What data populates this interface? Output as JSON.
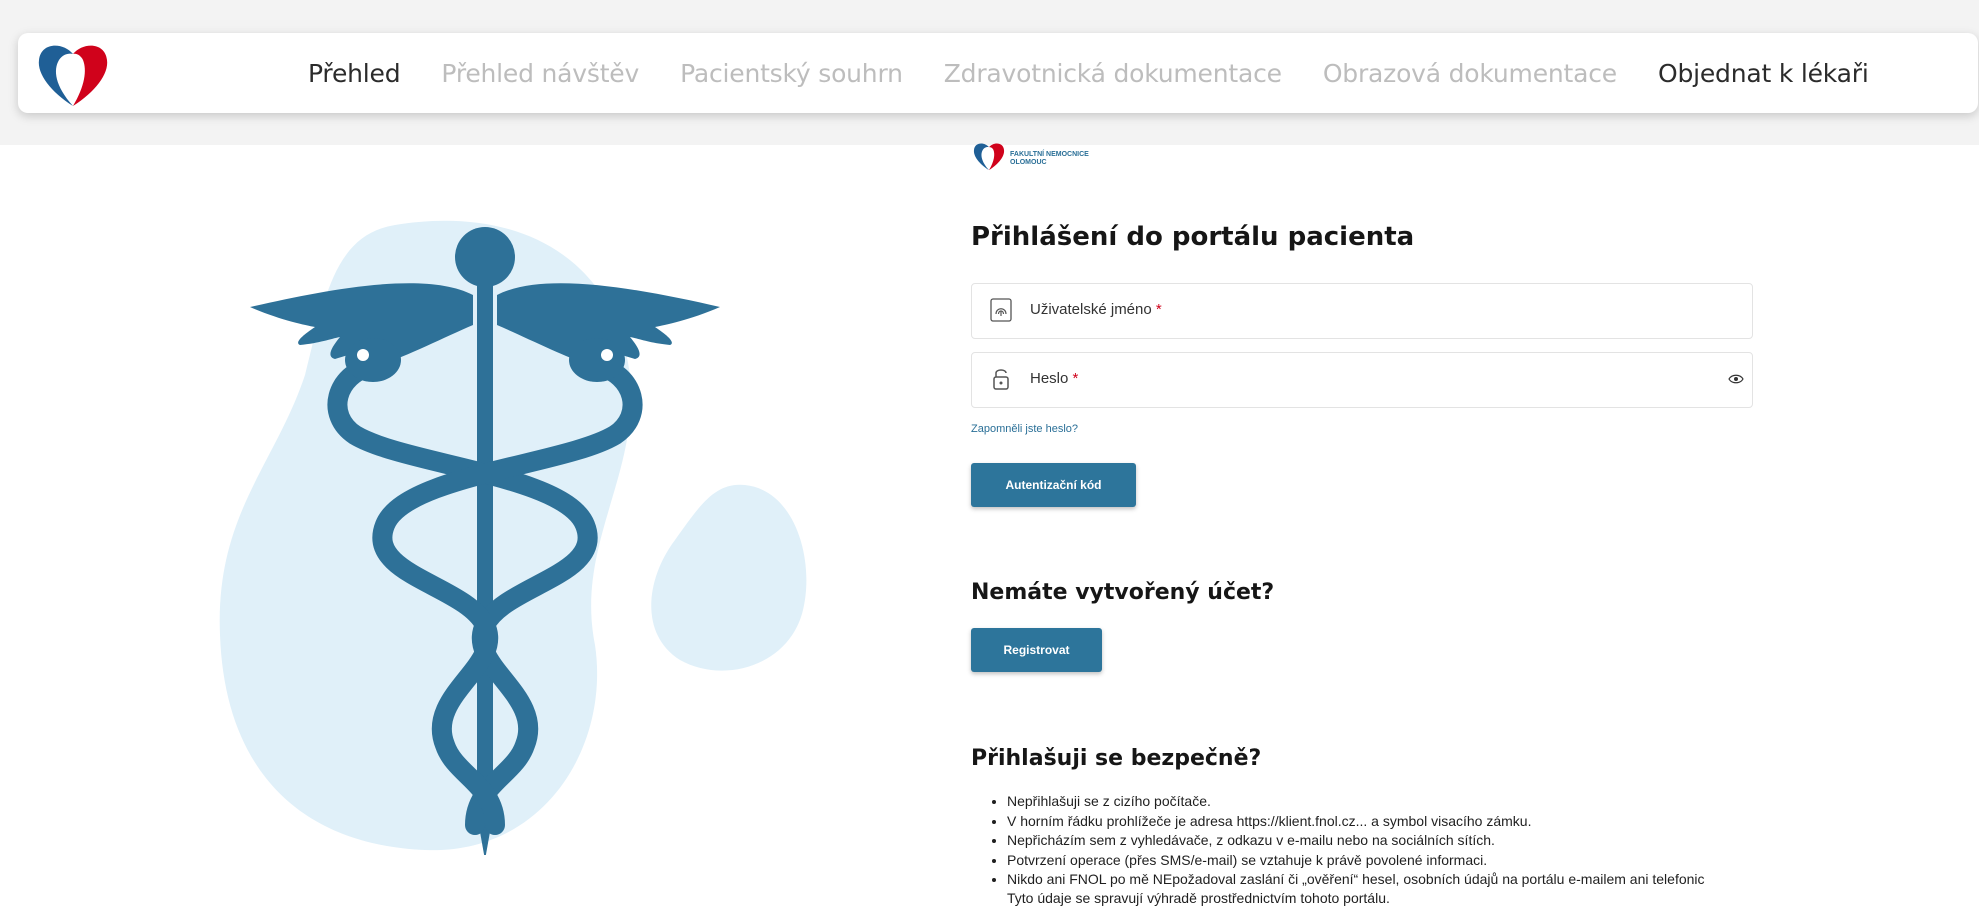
{
  "nav": {
    "tabs": [
      {
        "label": "Přehled",
        "active": true
      },
      {
        "label": "Přehled návštěv",
        "active": false
      },
      {
        "label": "Pacientský souhrn",
        "active": false
      },
      {
        "label": "Zdravotnická dokumentace",
        "active": false
      },
      {
        "label": "Obrazová dokumentace",
        "active": false
      },
      {
        "label": "Objednat k lékaři",
        "active": false
      }
    ]
  },
  "brand": {
    "logo_line1": "FAKULTNÍ NEMOCNICE",
    "logo_line2": "OLOMOUC",
    "primary_color": "#2d759b",
    "accent_color": "#d0021b"
  },
  "login": {
    "title": "Přihlášení do portálu pacienta",
    "username_label": "Uživatelské jméno",
    "password_label": "Heslo",
    "required_mark": "*",
    "forgot_link": "Zapomněli jste heslo?",
    "auth_button": "Autentizační kód"
  },
  "register": {
    "title": "Nemáte vytvořený účet?",
    "button": "Registrovat"
  },
  "security": {
    "title": "Přihlašuji se bezpečně?",
    "tips": [
      "Nepřihlašuji se z cizího počítače.",
      "V horním řádku prohlížeče je adresa https://klient.fnol.cz... a symbol visacího zámku.",
      "Nepřicházím sem z vyhledávače, z odkazu v e-mailu nebo na sociálních sítích.",
      "Potvrzení operace (přes SMS/e-mail) se vztahuje k právě povolené informaci.",
      "Nikdo ani FNOL po mě NEpožadoval zaslání či „ověření“ hesel, osobních údajů na portálu e-mailem ani telefonic"
    ],
    "tip_continuation": "Tyto údaje se spravují výhradě prostřednictvím tohoto portálu."
  },
  "icons": {
    "nav_logo": "heart-logo-icon",
    "username": "fingerprint-icon",
    "password": "padlock-icon",
    "show_password": "eye-icon",
    "illustration": "caduceus-icon"
  }
}
